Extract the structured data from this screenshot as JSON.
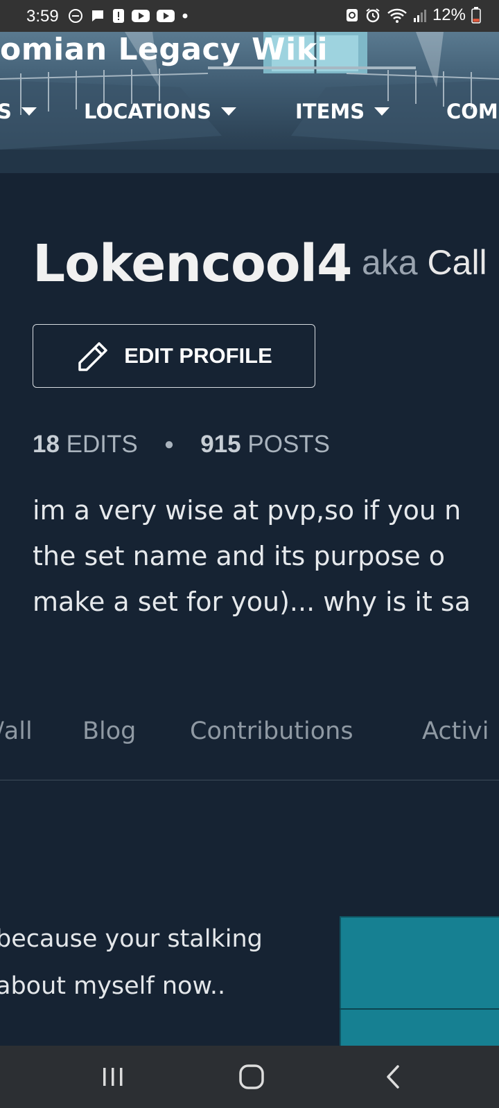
{
  "status_bar": {
    "time": "3:59",
    "battery_pct": "12%",
    "icons_left": [
      "dnd-icon",
      "chat-icon",
      "alert-icon",
      "youtube-icon",
      "youtube-icon",
      "dot-icon"
    ],
    "icons_right": [
      "recycle-icon",
      "alarm-icon",
      "wifi-icon",
      "signal-icon",
      "battery-icon"
    ]
  },
  "header": {
    "wiki_title": "omian Legacy Wiki",
    "nav": [
      {
        "label": "S"
      },
      {
        "label": "LOCATIONS"
      },
      {
        "label": "ITEMS"
      },
      {
        "label": "COM"
      }
    ]
  },
  "profile": {
    "username": "Lokencool4",
    "aka_label": "aka",
    "aka_name": "Call",
    "edit_label": "EDIT PROFILE",
    "edits_count": "18",
    "edits_label": "EDITS",
    "posts_count": "915",
    "posts_label": "POSTS",
    "bio_lines": [
      "im a very wise at pvp,so if you n",
      "the set name and its purpose o",
      "make a set for you)... why is it sa"
    ]
  },
  "tabs": [
    {
      "label": "/all"
    },
    {
      "label": "Blog"
    },
    {
      "label": "Contributions"
    },
    {
      "label": "Activi"
    }
  ],
  "message": {
    "lines": [
      "because your stalking",
      "about myself now.."
    ]
  },
  "colors": {
    "background": "#162333",
    "teal_card": "#168092"
  }
}
